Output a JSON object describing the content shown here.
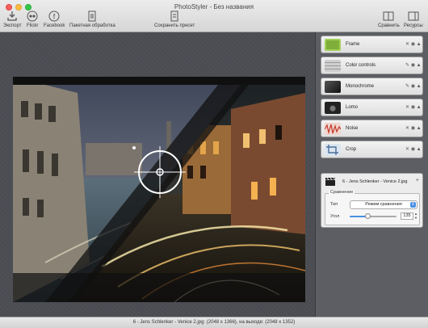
{
  "window": {
    "title": "PhotoStyler - Без названия"
  },
  "toolbar": {
    "export": "Экспорт",
    "flickr": "Flickr",
    "facebook": "Facebook",
    "batch": "Пакетная обработка",
    "save_preset": "Сохранить пресет",
    "compare": "Сравнить",
    "resources": "Ресурсы"
  },
  "effects": [
    {
      "name": "Frame",
      "actions": "✕ ◉ ▲",
      "thumb_color": "#7fae3a"
    },
    {
      "name": "Color controls",
      "actions": "✎ ◉ ▲",
      "thumb_color": "#cfcfcf"
    },
    {
      "name": "Monochrome",
      "actions": "✎ ◉ ▲",
      "thumb_color": "#333333"
    },
    {
      "name": "Lomo",
      "actions": "✕ ◉ ▲",
      "thumb_color": "#222222"
    },
    {
      "name": "Noise",
      "actions": "✕ ◉ ▲",
      "thumb_color": "#c0392b"
    },
    {
      "name": "Crop",
      "actions": "✕ ◉ ▲",
      "thumb_color": "#6a8fb8"
    }
  ],
  "source": {
    "file_name": "6 - Jens Schlenker - Venice 2.jpg",
    "group_title": "Сравнение",
    "type_label": "Тип",
    "type_value": "Режим сравнения",
    "angle_label": "Угол",
    "angle_value": "135",
    "angle_fraction": 0.375
  },
  "status": {
    "text": "6 - Jens Schlenker - Venice 2.jpg: (2048 x 1366), на выходе: (2048 x 1352)"
  },
  "colors": {
    "accent": "#4a90e2",
    "workspace": "#4b4d53"
  }
}
